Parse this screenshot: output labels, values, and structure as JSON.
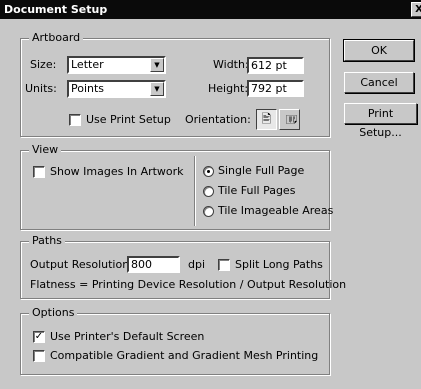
{
  "window": {
    "title": "Document Setup",
    "close_glyph": "X"
  },
  "artboard": {
    "legend": "Artboard",
    "size_label": "Size:",
    "size_value": "Letter",
    "units_label": "Units:",
    "units_value": "Points",
    "width_label": "Width:",
    "width_value": "612 pt",
    "height_label": "Height:",
    "height_value": "792 pt",
    "use_print_setup_label": "Use Print Setup",
    "use_print_setup_checked": false,
    "orientation_label": "Orientation:",
    "orientation_selected": "portrait"
  },
  "view": {
    "legend": "View",
    "show_images_label": "Show Images In Artwork",
    "show_images_checked": false,
    "radios": [
      "Single Full Page",
      "Tile Full Pages",
      "Tile Imageable Areas"
    ],
    "selected": "Single Full Page"
  },
  "paths": {
    "legend": "Paths",
    "output_resolution_label": "Output Resolution:",
    "output_resolution_value": "800",
    "dpi_label": "dpi",
    "split_long_paths_label": "Split Long Paths",
    "split_long_paths_checked": false,
    "flatness_text": "Flatness = Printing Device Resolution / Output Resolution"
  },
  "options": {
    "legend": "Options",
    "use_default_screen_label": "Use Printer's Default Screen",
    "use_default_screen_checked": true,
    "compatible_gradient_label": "Compatible Gradient and Gradient Mesh Printing",
    "compatible_gradient_checked": false
  },
  "buttons": {
    "ok": "OK",
    "cancel": "Cancel",
    "print_setup": "Print Setup..."
  }
}
